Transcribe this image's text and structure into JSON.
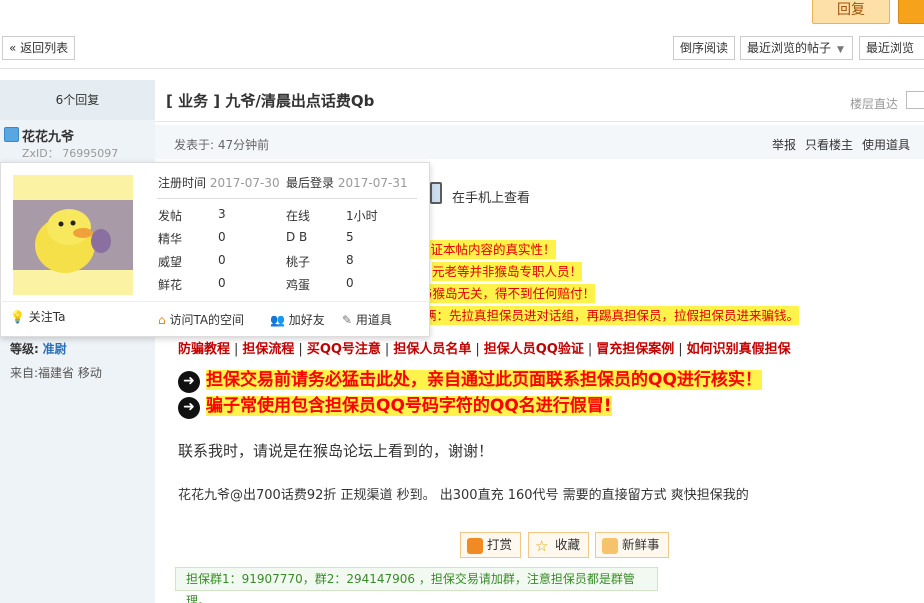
{
  "header": {
    "reply_label": "回复"
  },
  "toolbar": {
    "back_label": "« 返回列表",
    "reverse_label": "倒序阅读",
    "recent_posts_label": "最近浏览的帖子",
    "recent_boards_label": "最近浏览"
  },
  "sidebar": {
    "reply_count": "6个回复",
    "username": "花花九爷",
    "zxid": "ZxID： 76995097",
    "level_label": "等级:",
    "level_value": "准尉",
    "from": "来自:福建省 移动"
  },
  "card": {
    "register_label": "注册时间",
    "register_value": "2017-07-30",
    "last_login_label": "最后登录",
    "last_login_value": "2017-07-31",
    "stats": [
      {
        "label": "发帖",
        "value": "3"
      },
      {
        "label": "精华",
        "value": "0"
      },
      {
        "label": "威望",
        "value": "0"
      },
      {
        "label": "鲜花",
        "value": "0"
      }
    ],
    "stats2": [
      {
        "label": "在线",
        "value": "1小时"
      },
      {
        "label": "D B",
        "value": "5"
      },
      {
        "label": "桃子",
        "value": "8"
      },
      {
        "label": "鸡蛋",
        "value": "0"
      }
    ],
    "follow_label": "关注Ta",
    "visit_label": "访问TA的空间",
    "add_friend_label": "加好友",
    "use_item_label": "用道具"
  },
  "post": {
    "title": "[ 业务 ] 九爷/清晨出点话费Qb",
    "floor_label": "楼层直达",
    "posted": "发表于: 47分钟前",
    "report_label": "举报",
    "only_author_label": "只看楼主",
    "use_item_label": "使用道具",
    "mobile_label": "在手机上查看",
    "warn1": "保证本帖内容的真实性！",
    "warn2": "元老等并非猴岛专职人员！",
    "warn3": "与猴岛无关，得不到任何赔付！",
    "warn4": "俩：先拉真担保员进对话组，再踢真担保员，拉假担保员进来骗钱。",
    "links": [
      "防骗教程",
      "担保流程",
      "买QQ号注意",
      "担保人员名单",
      "担保人员QQ验证",
      "冒充担保案例",
      "如何识别真假担保"
    ],
    "big1": "担保交易前请务必猛击此处，亲自通过此页面联系担保员的QQ进行核实！",
    "big2": "骗子常使用包含担保员QQ号码字符的QQ名进行假冒!",
    "contact": "联系我时，请说是在猴岛论坛上看到的，谢谢！",
    "content": "花花九爷@出700话费92折 正规渠道 秒到。 出300直充 160代号 需要的直接留方式  爽快担保我的",
    "tip_label": "打赏",
    "fav_label": "收藏",
    "fresh_label": "新鲜事",
    "footer": "担保群1：91907770，群2：294147906 ，担保交易请加群，注意担保员都是群管理。"
  }
}
